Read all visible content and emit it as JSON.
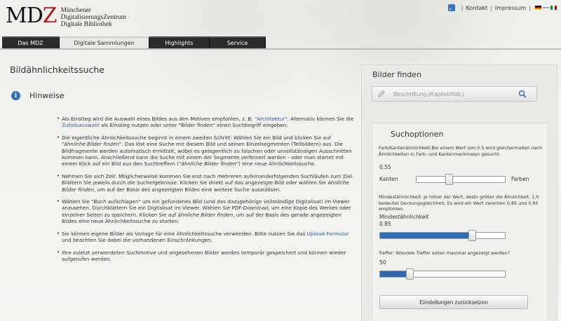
{
  "header": {
    "logo_letters_dark": "MD",
    "logo_letter_red": "Z",
    "logo_lines": [
      "Münchener",
      "DigitalisierungsZentrum",
      "Digitale Bibliothek"
    ],
    "links": [
      "Kontakt",
      "Impressum"
    ],
    "separator": "|"
  },
  "nav": {
    "tabs": [
      {
        "label": "Das MDZ",
        "active": false
      },
      {
        "label": "Digitale Sammlungen",
        "active": true
      },
      {
        "label": "Highlights",
        "active": false
      },
      {
        "label": "Service",
        "active": false
      }
    ]
  },
  "main": {
    "title": "Bildähnlichkeitssuche",
    "hint_title": "Hinweise",
    "hints": [
      {
        "parts": [
          "Als Einstieg wird die Auswahl eines Bildes aus den Motiven empfohlen, z. B. ",
          "\"Architektur\"",
          ". Alternativ können Sie die ",
          "Zufallsauswahl",
          " als Einstieg nutzen oder unter \"Bilder finden\" einen Suchbegriff eingeben."
        ]
      },
      {
        "parts": [
          "Die eigentliche Ähnlichkeitssuche beginnt in einem zweiten Schritt: Wählen Sie ein Bild und klicken Sie auf ",
          "\"ähnliche Bilder finden\"",
          ". Das löst eine Suche mit diesem Bild und seinen Einzelsegmenten (Teilbildern) aus. Die Bildfragmente werden automatisch ermittelt, wobei es gelegentlich zu falschen oder unvollständigen Ausschnitten kommen kann. Anschließend kann die Suche mit einem der Segmente verfeinert werden - oder man startet mit einem Klick auf ein Bild aus den Suchtreffern (",
          "\"ähnliche Bilder finden\"",
          ") eine neue Ähnlichkeitssuche."
        ]
      },
      {
        "parts": [
          "Nehmen Sie sich Zeit: Möglicherweise kommen Sie erst nach mehreren aufeinanderfolgenden Suchläufen zum Ziel. Blättern Sie jeweils durch die Suchergebnisse. Klicken Sie direkt auf das angezeigte Bild oder wählen Sie ",
          "ähnliche Bilder finden",
          ", um auf der Basis des angezeigten Bildes eine weitere Suche auszulösen."
        ]
      },
      {
        "parts": [
          "Wählen Sie \"",
          "Buch aufschlagen",
          "\" um ein gefundenes Bild (und das dazugehörige vollständige Digitalisat) im Viewer anzusehen. Durchblättern Sie ein Digitalisat im Viewer. Wählen Sie ",
          "PDF-Download",
          ", um eine Kopie des Werkes oder einzelner Seiten zu speichern. Klicken Sie auf ",
          "ähnliche Bilder finden",
          ", um auf der Basis des gerade angezeigten Bildes eine neue Ähnlichkeitssuche zu starten."
        ]
      },
      {
        "parts": [
          "Sie können eigene Bilder als Vorlage für eine Ähnlichkeitssuche verwenden. Bitte nutzen Sie das ",
          "Upload-Formular",
          " und beachten Sie dabei die vorhandenen Einschränkungen."
        ]
      },
      {
        "parts": [
          "Ihre zuletzt verwendeten Suchmotive und angesehenen Bilder werden temporär gespeichert und können wieder aufgerufen werden."
        ]
      }
    ]
  },
  "sidebar": {
    "title": "Bilder finden",
    "search_placeholder": "Beschriftung (Kapitel/Abb.)",
    "options": {
      "title": "Suchoptionen",
      "edge_desc": "Farb/Kantenähnlichkeit:Bei einem Wert von 0.5 wird gleichermaßen nach Ähnlichkeiten in Farb- und Kantenmerkmalen gesucht.",
      "edge_value": "0.55",
      "edge_left": "Kanten",
      "edge_right": "Farben",
      "edge_fraction": 0.37,
      "sim_desc": "Mindestähnlichkeit: Je höher der Wert, desto größer die Ähnlichkeit. 1.0 bedeutet Deckungsgleichheit. Es wird ein Wert zwischen 0.85 und 0.95 empfohlen.",
      "sim_label": "Mindestähnlichkeit",
      "sim_value": "0.85",
      "sim_fraction": 0.74,
      "hits_desc": "Treffer: Wieviele Treffer sollen maximal angezeigt werden?",
      "hits_value": "50",
      "hits_fraction": 0.24,
      "reset_label": "Einstellungen zurücksetzen"
    }
  }
}
